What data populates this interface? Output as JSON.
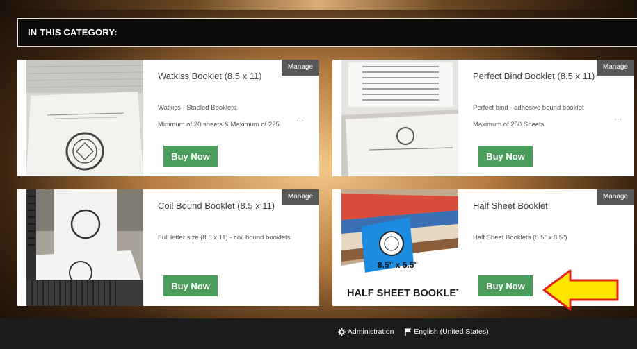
{
  "category_header": "IN THIS CATEGORY:",
  "manage_label": "Manage",
  "buy_label": "Buy Now",
  "products": [
    {
      "title": "Watkiss Booklet (8.5 x 11)",
      "desc_lines": [
        "Watkiss - Stapled Booklets.",
        "Minimum of 20 sheets & Maximum of 225"
      ],
      "more": "···"
    },
    {
      "title": "Perfect Bind Booklet (8.5 x 11)",
      "desc_lines": [
        "Perfect bind - adhesive bound booklet",
        "Maximum of 250 Sheets"
      ],
      "more": "···"
    },
    {
      "title": "Coil Bound Booklet (8.5 x 11)",
      "desc_lines": [
        "Full letter size (8.5 x 11) - coil bound booklets"
      ]
    },
    {
      "title": "Half Sheet Booklet",
      "desc_lines": [
        "Half Sheet Booklets (5.5\" x 8.5\")"
      ],
      "image_caption": "HALF SHEET BOOKLET",
      "image_size_label": "8.5\" x 5.5\""
    }
  ],
  "footer": {
    "admin_label": "Administration",
    "language_label": "English (United States)"
  },
  "colors": {
    "buy_button": "#4a9d5b",
    "manage_badge": "#585858",
    "arrow_fill": "#ffe600",
    "arrow_stroke": "#e0231b"
  }
}
